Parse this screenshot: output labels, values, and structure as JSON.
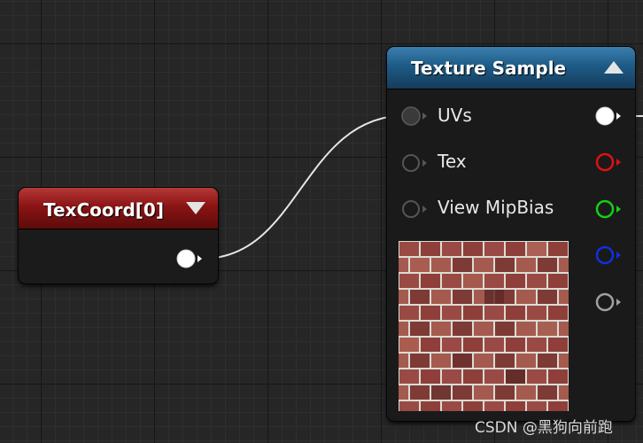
{
  "nodes": {
    "texcoord": {
      "title": "TexCoord[0]",
      "header_color": "#8a1414"
    },
    "texture_sample": {
      "title": "Texture Sample",
      "header_color": "#1d5b87",
      "inputs": [
        {
          "label": "UVs"
        },
        {
          "label": "Tex"
        },
        {
          "label": "View MipBias"
        }
      ],
      "outputs": [
        {
          "channel": "rgb",
          "color": "#ffffff"
        },
        {
          "channel": "r",
          "color": "#e01010"
        },
        {
          "channel": "g",
          "color": "#14d014"
        },
        {
          "channel": "b",
          "color": "#1030e0"
        },
        {
          "channel": "a",
          "color": "#a0a0a0"
        }
      ],
      "preview": "brick-texture"
    }
  },
  "watermark": "CSDN @黑狗向前跑"
}
